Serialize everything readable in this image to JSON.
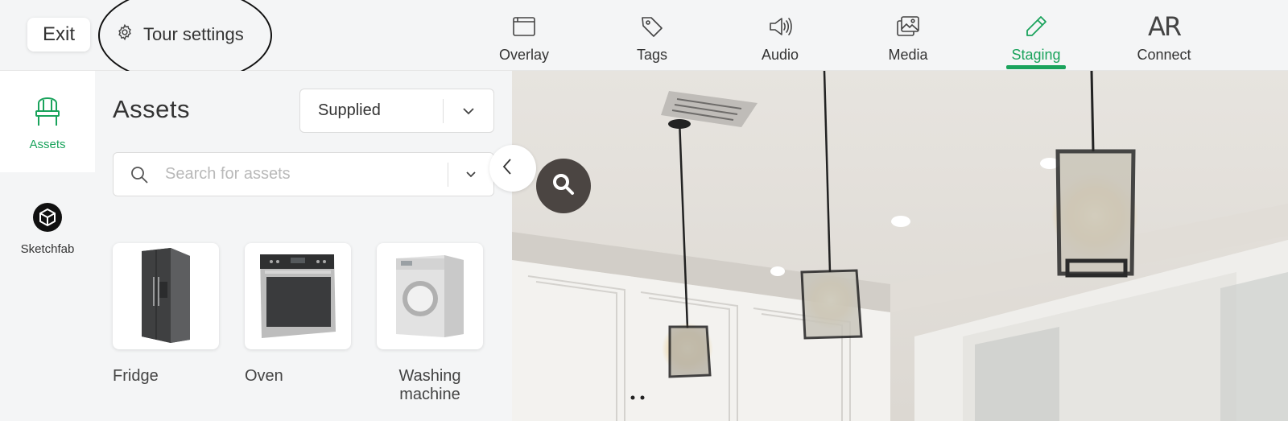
{
  "topbar": {
    "exit_label": "Exit",
    "tour_settings_label": "Tour settings",
    "nav": [
      {
        "label": "Overlay",
        "icon": "browser-window-icon"
      },
      {
        "label": "Tags",
        "icon": "tag-icon"
      },
      {
        "label": "Audio",
        "icon": "speaker-icon"
      },
      {
        "label": "Media",
        "icon": "images-icon"
      },
      {
        "label": "Staging",
        "icon": "pencil-icon",
        "active": true
      },
      {
        "label": "Connect",
        "icon": "ar-icon"
      }
    ],
    "ar_glyph": "AR"
  },
  "rail": {
    "items": [
      {
        "label": "Assets",
        "icon": "chair-icon",
        "active": true
      },
      {
        "label": "Sketchfab",
        "icon": "sketchfab-logo-icon"
      }
    ]
  },
  "panel": {
    "title": "Assets",
    "source_value": "Supplied",
    "search_placeholder": "Search for assets",
    "assets": [
      {
        "label": "Fridge"
      },
      {
        "label": "Oven"
      },
      {
        "label": "Washing machine"
      }
    ]
  },
  "viewer": {
    "collapse_icon": "chevron-left-icon",
    "zoom_icon": "magnifier-icon"
  },
  "colors": {
    "accent": "#1aa35c",
    "background": "#f4f5f6",
    "text": "#333333"
  }
}
